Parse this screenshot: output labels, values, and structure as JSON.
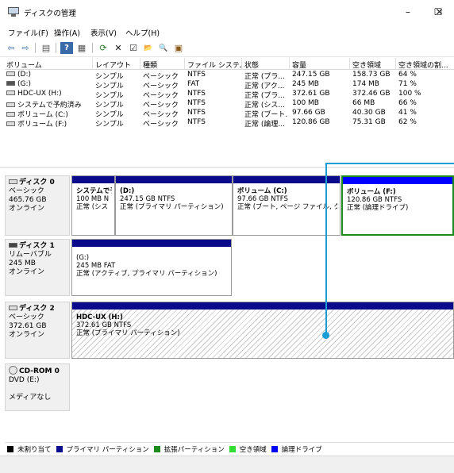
{
  "window": {
    "title": "ディスクの管理",
    "min_label": "–",
    "max_label": "☐",
    "close_label": "✕"
  },
  "menu": [
    "ファイル(F)",
    "操作(A)",
    "表示(V)",
    "ヘルプ(H)"
  ],
  "toolbar": {
    "icons": [
      "back-arrow-icon",
      "forward-arrow-icon",
      "list-view-icon",
      "help-icon",
      "properties-icon",
      "refresh-icon",
      "delete-icon",
      "checklist-icon",
      "folder-open-icon",
      "search-icon",
      "settings-icon"
    ],
    "glyphs": [
      "⇦",
      "⇨",
      "▤",
      "?",
      "▦",
      "⟳",
      "✕",
      "☑",
      "📂",
      "🔍",
      "▣"
    ]
  },
  "volumes": {
    "headers": [
      "ボリューム",
      "レイアウト",
      "種類",
      "ファイル システム",
      "状態",
      "容量",
      "空き領域",
      "空き領域の割..."
    ],
    "rows": [
      {
        "name": "(D:)",
        "layout": "シンプル",
        "type": "ベーシック",
        "fs": "NTFS",
        "status": "正常 (プラ...",
        "capacity": "247.15 GB",
        "free": "158.73 GB",
        "pct": "64 %",
        "icon": "disk-icon"
      },
      {
        "name": "(G:)",
        "layout": "シンプル",
        "type": "ベーシック",
        "fs": "FAT",
        "status": "正常 (アク...",
        "capacity": "245 MB",
        "free": "174 MB",
        "pct": "71 %",
        "icon": "removable-disk-icon"
      },
      {
        "name": "HDC-UX (H:)",
        "layout": "シンプル",
        "type": "ベーシック",
        "fs": "NTFS",
        "status": "正常 (プラ...",
        "capacity": "372.61 GB",
        "free": "372.46 GB",
        "pct": "100 %",
        "icon": "disk-icon"
      },
      {
        "name": "システムで予約済み",
        "layout": "シンプル",
        "type": "ベーシック",
        "fs": "NTFS",
        "status": "正常 (シス...",
        "capacity": "100 MB",
        "free": "66 MB",
        "pct": "66 %",
        "icon": "disk-icon"
      },
      {
        "name": "ボリューム (C:)",
        "layout": "シンプル",
        "type": "ベーシック",
        "fs": "NTFS",
        "status": "正常 (ブート...",
        "capacity": "97.66 GB",
        "free": "40.30 GB",
        "pct": "41 %",
        "icon": "disk-icon"
      },
      {
        "name": "ボリューム (F:)",
        "layout": "シンプル",
        "type": "ベーシック",
        "fs": "NTFS",
        "status": "正常 (論理...",
        "capacity": "120.86 GB",
        "free": "75.31 GB",
        "pct": "62 %",
        "icon": "disk-icon"
      }
    ]
  },
  "disks": [
    {
      "name": "ディスク 0",
      "kind": "ベーシック",
      "size": "465.76 GB",
      "state": "オンライン",
      "partitions": [
        {
          "name": "システムで予",
          "size": "100 MB N",
          "status": "正常 (シス"
        },
        {
          "name": "(D:)",
          "size": "247.15 GB NTFS",
          "status": "正常 (プライマリ パーティション)"
        },
        {
          "name": "ボリューム (C:)",
          "size": "97.66 GB NTFS",
          "status": "正常 (ブート, ページ ファイル, クラッ"
        },
        {
          "name": "ボリューム (F:)",
          "size": "120.86 GB NTFS",
          "status": "正常 (論理ドライブ)"
        }
      ]
    },
    {
      "name": "ディスク 1",
      "kind": "リムーバブル",
      "size": "245 MB",
      "state": "オンライン",
      "partitions": [
        {
          "name": "(G:)",
          "size": "245 MB FAT",
          "status": "正常 (アクティブ, プライマリ パーティション)"
        }
      ]
    },
    {
      "name": "ディスク 2",
      "kind": "ベーシック",
      "size": "372.61 GB",
      "state": "オンライン",
      "partitions": [
        {
          "name": "HDC-UX (H:)",
          "size": "372.61 GB NTFS",
          "status": "正常 (プライマリ パーティション)"
        }
      ]
    },
    {
      "name": "CD-ROM 0",
      "kind": "DVD (E:)",
      "size": "",
      "state": "メディアなし",
      "partitions": []
    }
  ],
  "legend": [
    {
      "label": "未割り当て",
      "color": "#000000"
    },
    {
      "label": "プライマリ パーティション",
      "color": "#0a0a8c"
    },
    {
      "label": "拡張パーティション",
      "color": "#1c8a1c"
    },
    {
      "label": "空き領域",
      "color": "#33dd33"
    },
    {
      "label": "論理ドライブ",
      "color": "#0000ff"
    }
  ],
  "colors": {
    "primary_bar": "#0a0a8c",
    "logical_bar": "#0000ff",
    "selection_border": "#1c8a1c",
    "callout": "#1a9cd6"
  }
}
